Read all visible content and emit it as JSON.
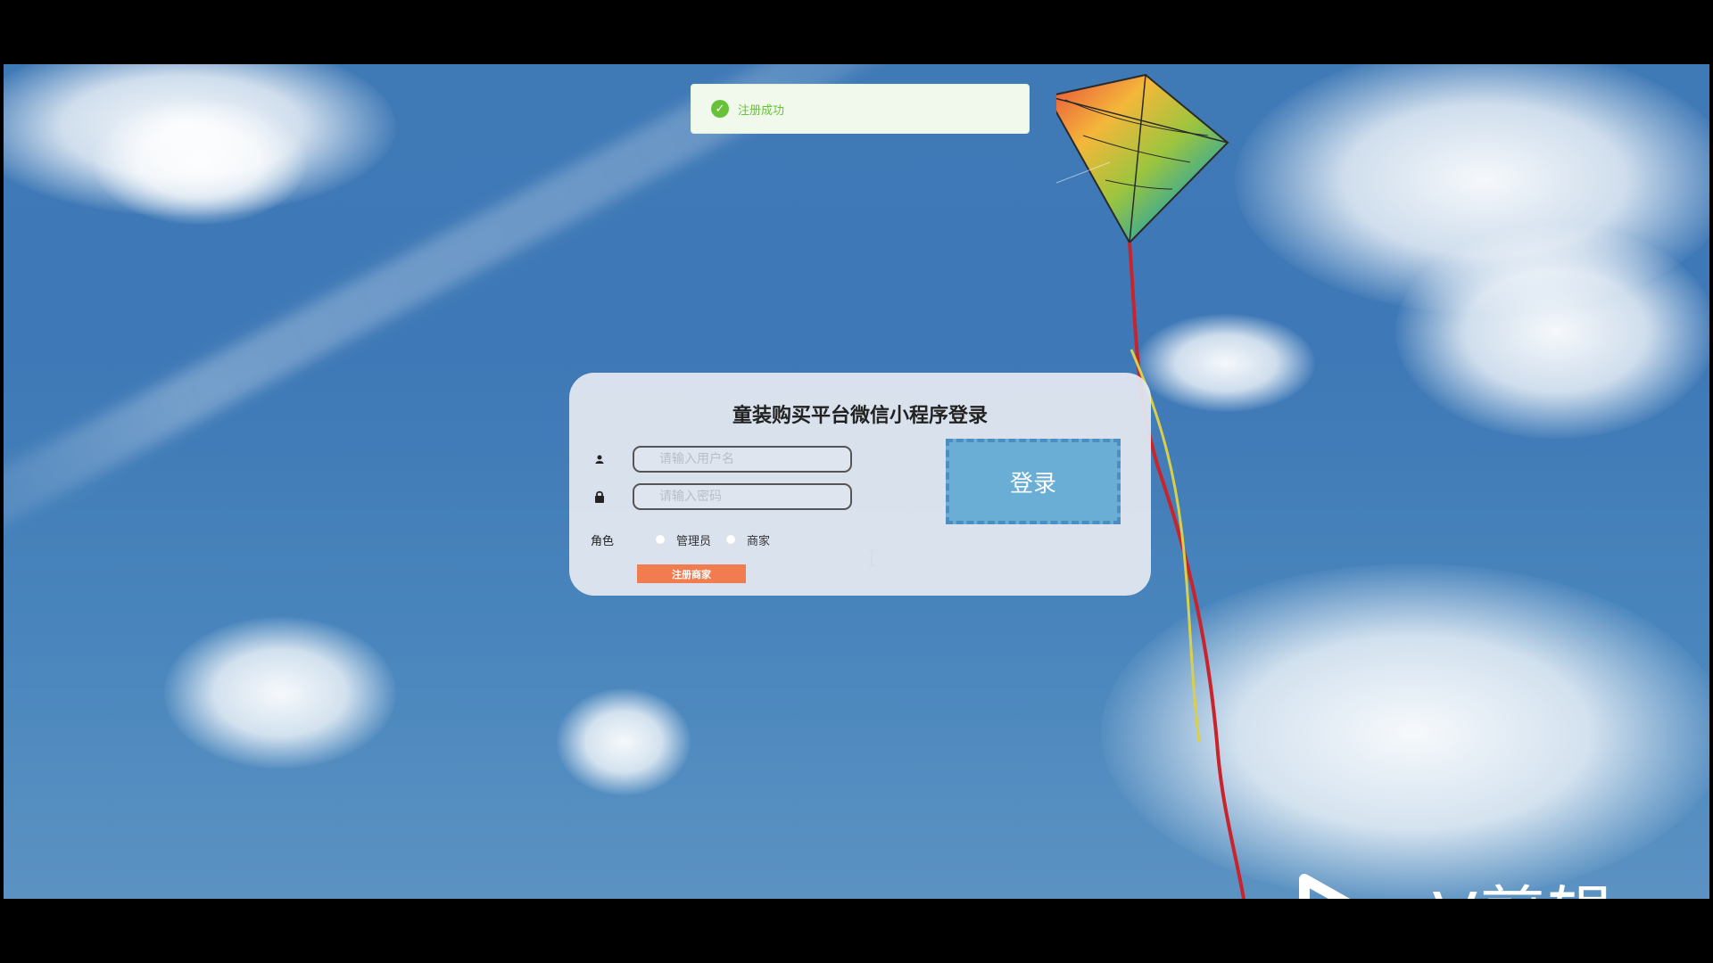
{
  "toast": {
    "message": "注册成功",
    "icon": "check-circle-icon",
    "color": "#67c23a"
  },
  "login": {
    "title": "童装购买平台微信小程序登录",
    "username_placeholder": "请输入用户名",
    "password_placeholder": "请输入密码",
    "role_label": "角色",
    "roles": [
      "管理员",
      "商家"
    ],
    "register_label": "注册商家",
    "login_label": "登录"
  },
  "watermark": {
    "text": "eV剪辑"
  },
  "colors": {
    "sky": "#3f79b6",
    "card": "#e2e8f0",
    "login_button": "#6aaed6",
    "register_button": "#f07c4f"
  }
}
